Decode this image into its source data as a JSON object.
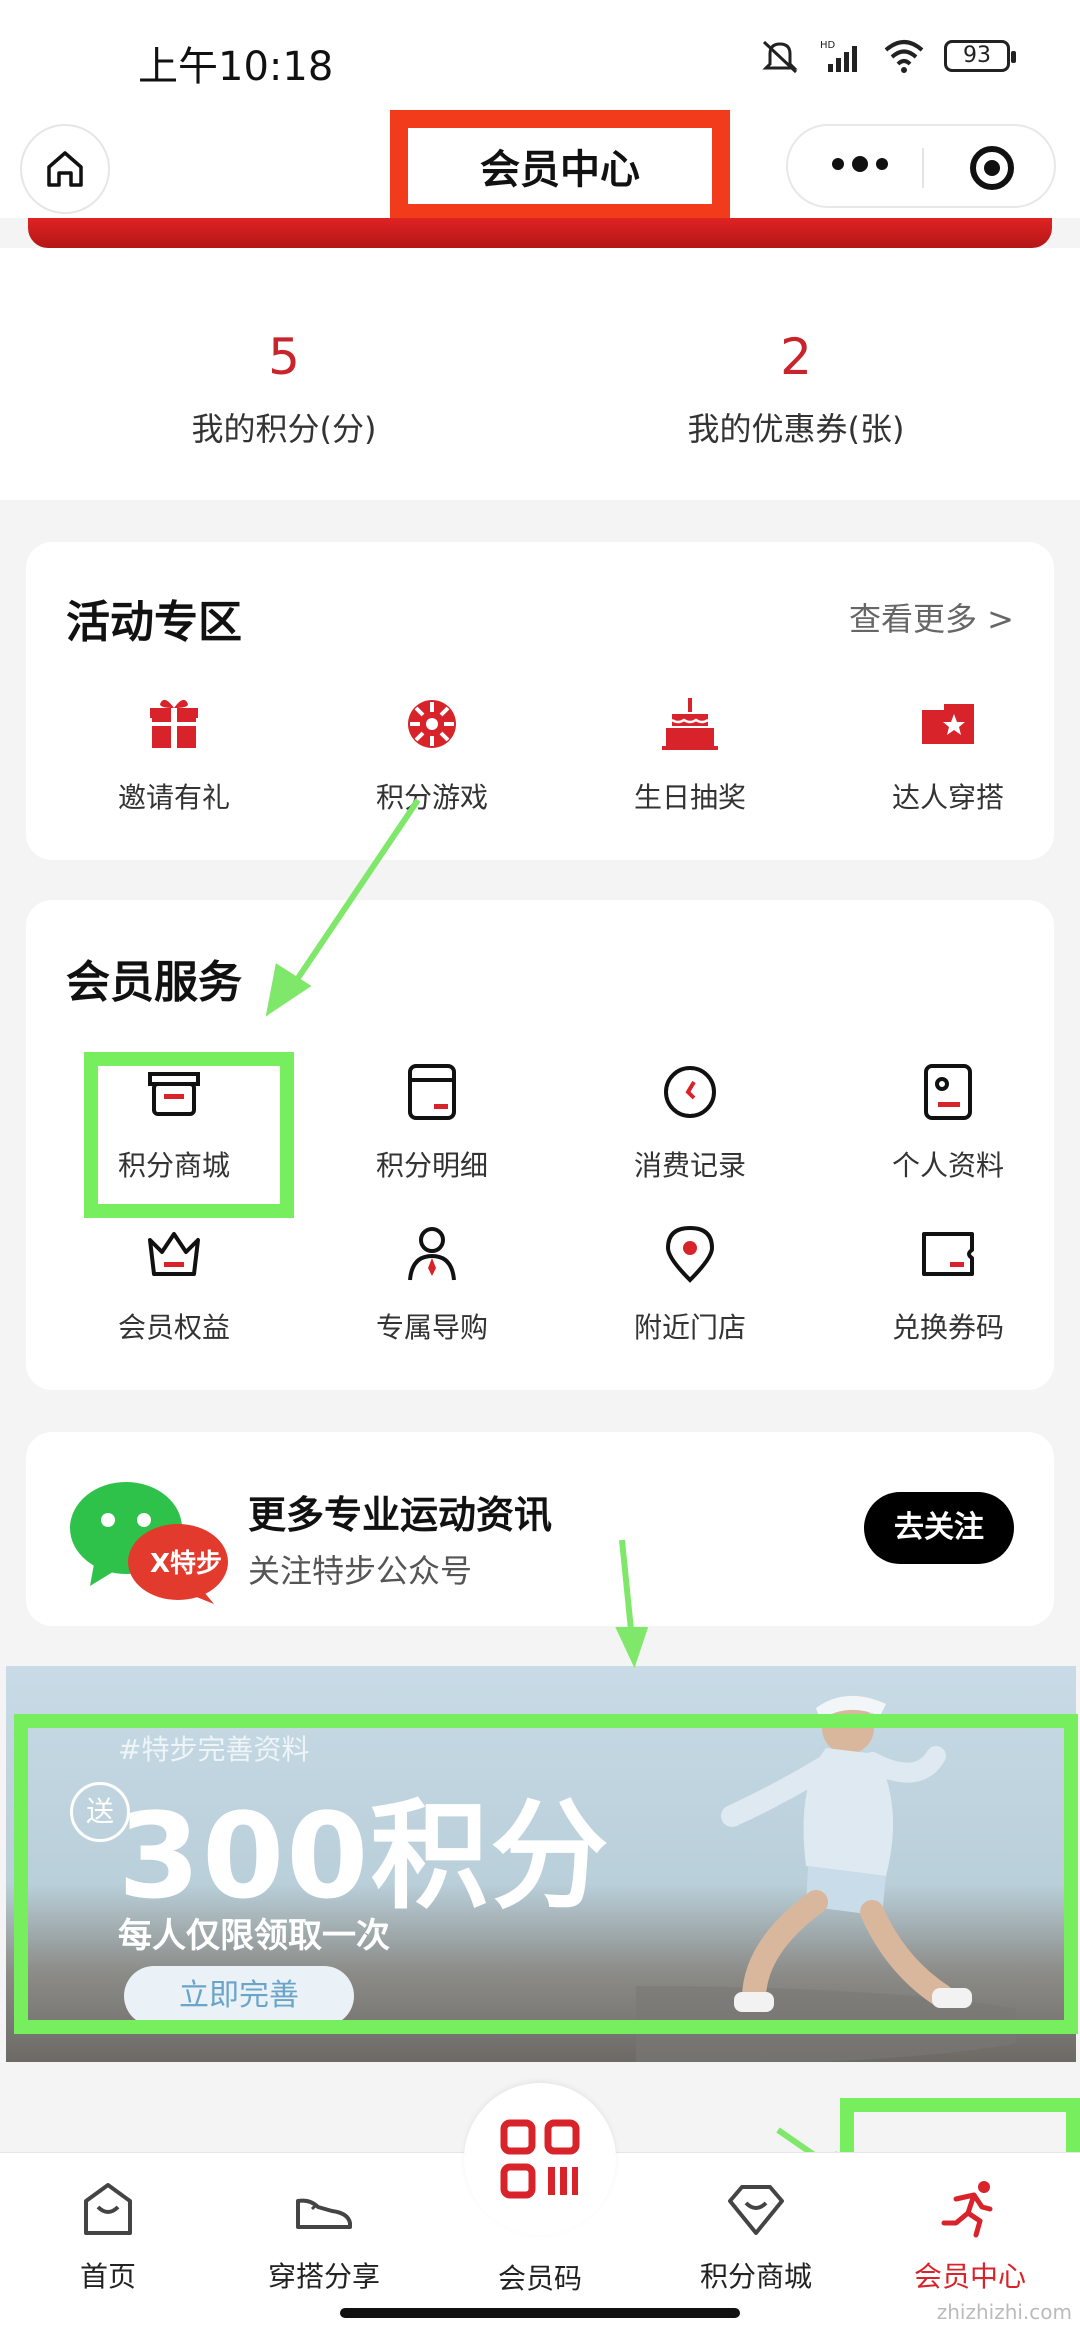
{
  "status_bar": {
    "time": "上午10:18",
    "battery": "93"
  },
  "nav": {
    "title": "会员中心"
  },
  "stats": [
    {
      "value": "5",
      "label": "我的积分(分)"
    },
    {
      "value": "2",
      "label": "我的优惠券(张)"
    }
  ],
  "activity": {
    "title": "活动专区",
    "view_more": "查看更多 >",
    "items": [
      {
        "label": "邀请有礼",
        "icon": "gift-icon"
      },
      {
        "label": "积分游戏",
        "icon": "game-wheel-icon"
      },
      {
        "label": "生日抽奖",
        "icon": "cake-icon"
      },
      {
        "label": "达人穿搭",
        "icon": "star-card-icon"
      }
    ]
  },
  "service": {
    "title": "会员服务",
    "items": [
      {
        "label": "积分商城",
        "icon": "shop-box-icon"
      },
      {
        "label": "积分明细",
        "icon": "detail-card-icon"
      },
      {
        "label": "消费记录",
        "icon": "clock-icon"
      },
      {
        "label": "个人资料",
        "icon": "profile-card-icon"
      },
      {
        "label": "会员权益",
        "icon": "crown-icon"
      },
      {
        "label": "专属导购",
        "icon": "person-tie-icon"
      },
      {
        "label": "附近门店",
        "icon": "location-pin-icon"
      },
      {
        "label": "兑换券码",
        "icon": "coupon-icon"
      }
    ]
  },
  "follow": {
    "title": "更多专业运动资讯",
    "subtitle": "关注特步公众号",
    "button": "去关注",
    "logo_text": "X特步"
  },
  "banner": {
    "hashtag": "#特步完善资料",
    "send": "送",
    "headline": "300积分",
    "subline": "每人仅限领取一次",
    "button": "立即完善"
  },
  "tabbar": [
    {
      "label": "首页",
      "icon": "home-bag-icon"
    },
    {
      "label": "穿搭分享",
      "icon": "shoe-icon"
    },
    {
      "label": "会员码",
      "icon": "qr-code-icon"
    },
    {
      "label": "积分商城",
      "icon": "diamond-bag-icon"
    },
    {
      "label": "会员中心",
      "icon": "runner-icon"
    }
  ],
  "watermark": "zhizhizhi.com",
  "colors": {
    "accent": "#d8232a",
    "highlight_green": "#77ee5e",
    "title_box_red": "#f23b1b"
  }
}
